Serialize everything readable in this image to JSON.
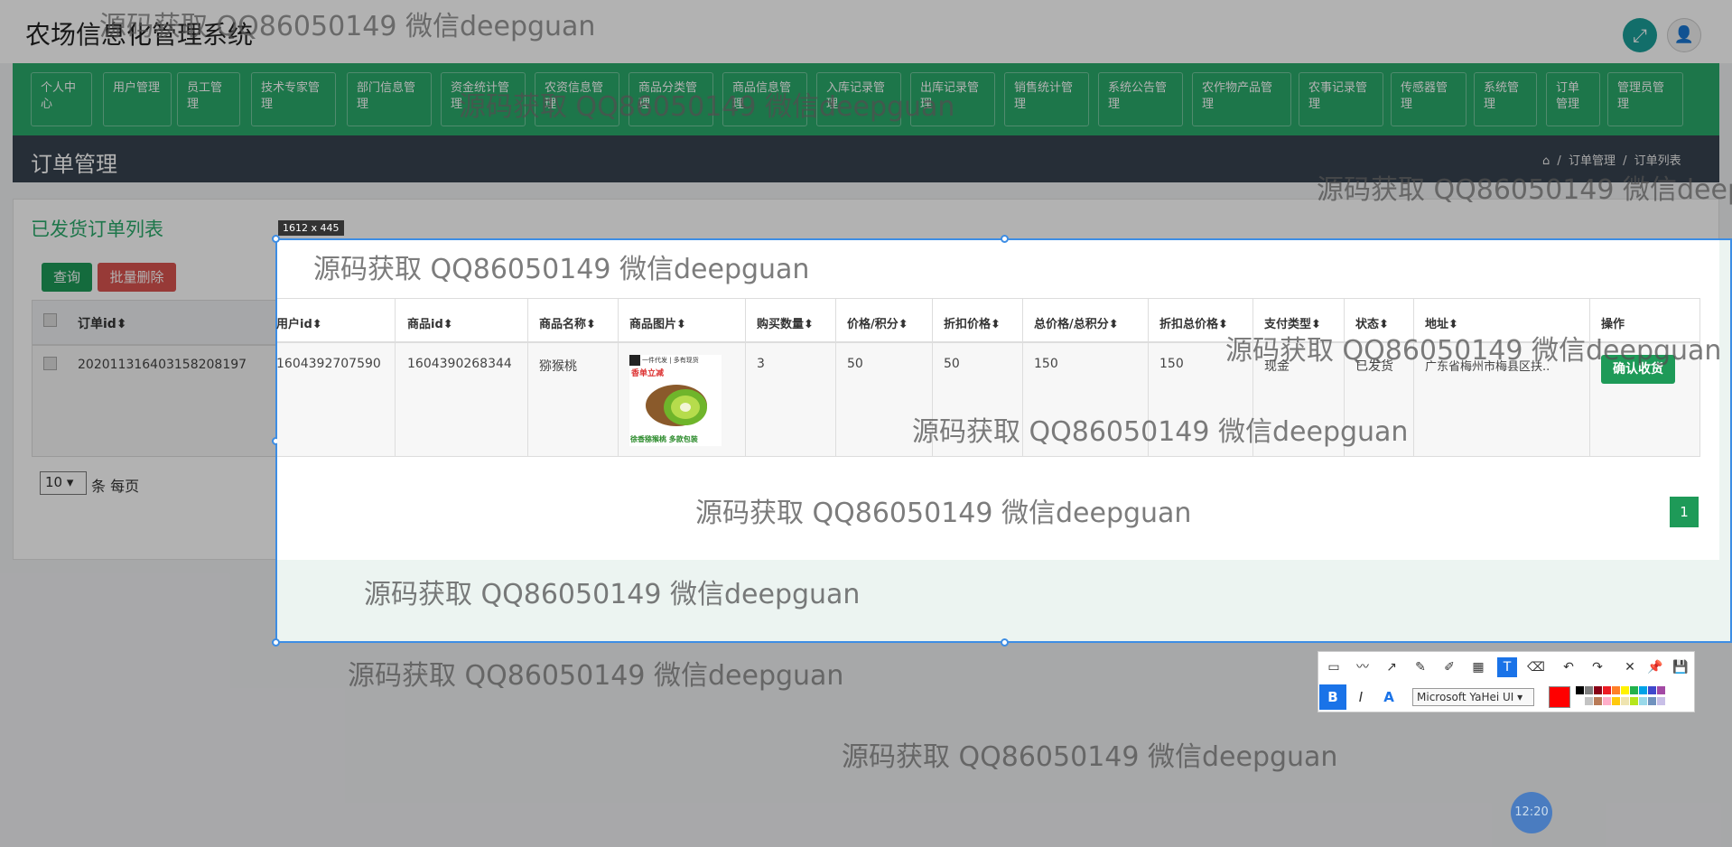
{
  "header": {
    "title": "农场信息化管理系统",
    "fullscreen_icon": "⤢",
    "user_icon": "👤"
  },
  "nav": {
    "items": [
      "个人中心",
      "用户管理",
      "员工管理",
      "技术专家管理",
      "部门信息管理",
      "资金统计管理",
      "农资信息管理",
      "商品分类管理",
      "商品信息管理",
      "入库记录管理",
      "出库记录管理",
      "销售统计管理",
      "系统公告管理",
      "农作物产品管理",
      "农事记录管理",
      "传感器管理",
      "系统管理",
      "订单管理",
      "管理员管理"
    ]
  },
  "page": {
    "heading": "订单管理",
    "breadcrumb": [
      "⌂",
      "订单管理",
      "订单列表"
    ],
    "breadcrumb_sep": "/"
  },
  "panel": {
    "title": "已发货订单列表",
    "query_label": "查询",
    "delete_label": "批量删除",
    "per_page_value": "10",
    "per_page_label": "条 每页"
  },
  "table": {
    "order_id_header": "订单id⬍",
    "order_id_value": "202011316403158208197",
    "headers": [
      "用户id⬍",
      "商品id⬍",
      "商品名称⬍",
      "商品图片⬍",
      "购买数量⬍",
      "价格/积分⬍",
      "折扣价格⬍",
      "总价格/总积分⬍",
      "折扣总价格⬍",
      "支付类型⬍",
      "状态⬍",
      "地址⬍",
      "操作"
    ],
    "row": [
      "1604392707590",
      "1604390268344",
      "猕猴桃",
      "",
      "3",
      "50",
      "50",
      "150",
      "150",
      "现金",
      "已发货",
      "广东省梅州市梅县区扶.."
    ],
    "action_label": "确认收货"
  },
  "product_image": {
    "top_text": "一件代发 | 多有现货",
    "badge": "香单立减",
    "bottom_text": "徐香猕猴桃 多款包装"
  },
  "pagination": {
    "current": "1"
  },
  "capture": {
    "size_label": "1612 x 445"
  },
  "watermark": "源码获取 QQ86050149 微信deepguan",
  "toolbar": {
    "icons": [
      "▭",
      "〰",
      "↗",
      "✎",
      "✐",
      "▦",
      "T",
      "⌫",
      "↶",
      "↷",
      "✕",
      "📌",
      "💾",
      "⎘"
    ],
    "bold": "B",
    "italic": "I",
    "outline": "A",
    "font": "Microsoft YaHei UI ▾",
    "current_color": "#ff0000",
    "palette": [
      "#000000",
      "#7f7f7f",
      "#880015",
      "#ed1c24",
      "#ff7f27",
      "#fff200",
      "#22b14c",
      "#00a2e8",
      "#3f48cc",
      "#a349a4",
      "#ffffff",
      "#c3c3c3",
      "#b97a57",
      "#ffaec9",
      "#ffc90e",
      "#efe4b0",
      "#b5e61d",
      "#99d9ea",
      "#7092be",
      "#c8bfe7"
    ]
  },
  "clock": {
    "time": "12:20"
  }
}
